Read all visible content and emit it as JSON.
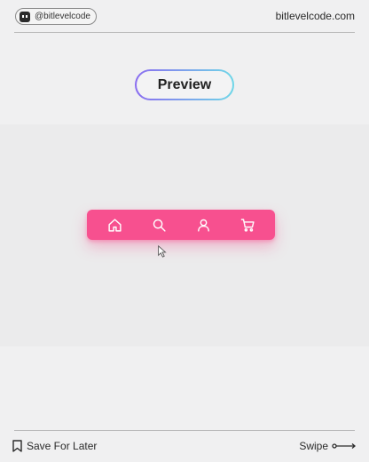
{
  "header": {
    "handle": "@bitlevelcode",
    "site": "bitlevelcode.com"
  },
  "preview_button": {
    "label": "Preview"
  },
  "navbar": {
    "color": "#f7508f",
    "items": [
      {
        "icon": "home-icon"
      },
      {
        "icon": "search-icon"
      },
      {
        "icon": "user-icon"
      },
      {
        "icon": "cart-icon"
      }
    ]
  },
  "footer": {
    "save_label": "Save For Later",
    "swipe_label": "Swipe"
  }
}
